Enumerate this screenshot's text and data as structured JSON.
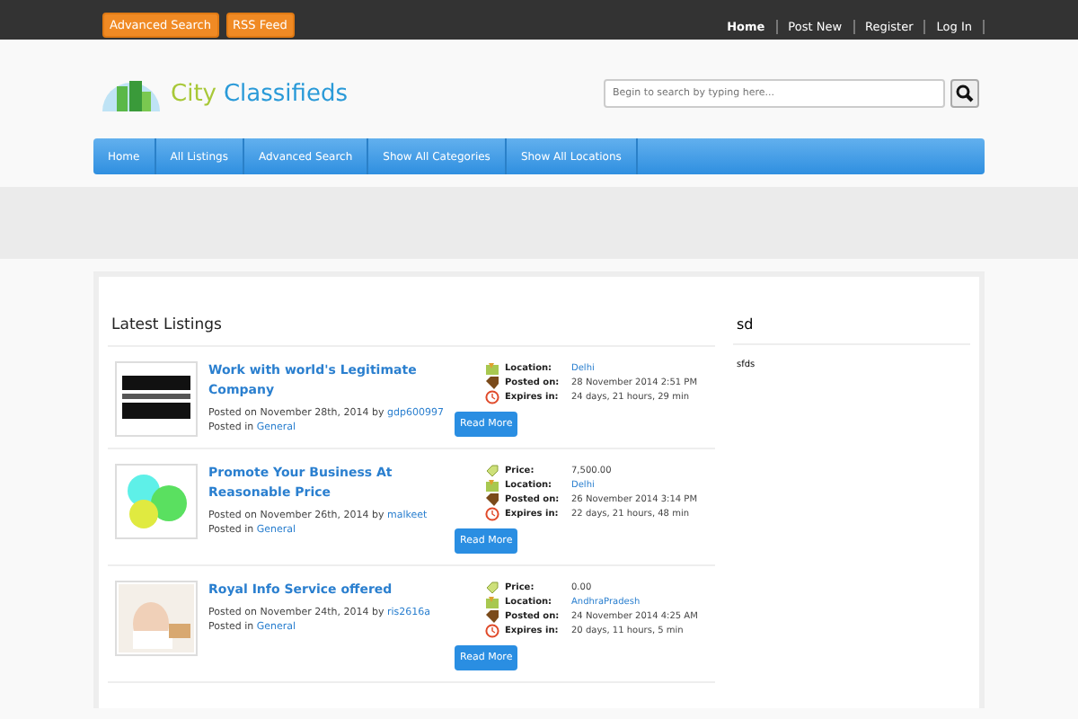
{
  "top_bar": {
    "buttons": [
      "Advanced Search",
      "RSS Feed"
    ],
    "links": [
      {
        "label": "Home",
        "selected": true
      },
      {
        "label": "Post New",
        "selected": false
      },
      {
        "label": "Register",
        "selected": false
      },
      {
        "label": "Log In",
        "selected": false
      }
    ]
  },
  "header": {
    "logo": {
      "word1": "City",
      "word2": "Classifieds"
    },
    "search": {
      "placeholder": "Begin to search by typing here..."
    }
  },
  "nav": [
    "Home",
    "All Listings",
    "Advanced Search",
    "Show All Categories",
    "Show All Locations"
  ],
  "main": {
    "heading": "Latest Listings",
    "listings": [
      {
        "title": "Work with world's Legitimate Company",
        "posted": "Posted on November 28th, 2014 by",
        "author": "gdp600997",
        "posted_in": "Posted in",
        "category": "General",
        "read_more": "Read More",
        "details": [
          {
            "kind": "location",
            "label": "Location:",
            "value": "Delhi"
          },
          {
            "kind": "posted",
            "label": "Posted on:",
            "value": "28 November 2014 2:51 PM"
          },
          {
            "kind": "expires",
            "label": "Expires in:",
            "value": "24 days, 21 hours, 29 min"
          }
        ]
      },
      {
        "title": "Promote Your Business At Reasonable Price",
        "posted": "Posted on November 26th, 2014 by",
        "author": "malkeet",
        "posted_in": "Posted in",
        "category": "General",
        "read_more": "Read More",
        "details": [
          {
            "kind": "price",
            "label": "Price:",
            "value": "7,500.00"
          },
          {
            "kind": "location",
            "label": "Location:",
            "value": "Delhi"
          },
          {
            "kind": "posted",
            "label": "Posted on:",
            "value": "26 November 2014 3:14 PM"
          },
          {
            "kind": "expires",
            "label": "Expires in:",
            "value": "22 days, 21 hours, 48 min"
          }
        ]
      },
      {
        "title": "Royal Info Service offered",
        "posted": "Posted on November 24th, 2014 by",
        "author": "ris2616a",
        "posted_in": "Posted in",
        "category": "General",
        "read_more": "Read More",
        "details": [
          {
            "kind": "price",
            "label": "Price:",
            "value": "0.00"
          },
          {
            "kind": "location",
            "label": "Location:",
            "value": "AndhraPradesh"
          },
          {
            "kind": "posted",
            "label": "Posted on:",
            "value": "24 November 2014 4:25 AM"
          },
          {
            "kind": "expires",
            "label": "Expires in:",
            "value": "20 days, 11 hours, 5 min"
          }
        ]
      }
    ]
  },
  "sidebar": {
    "heading": "sd",
    "text": "sfds"
  }
}
